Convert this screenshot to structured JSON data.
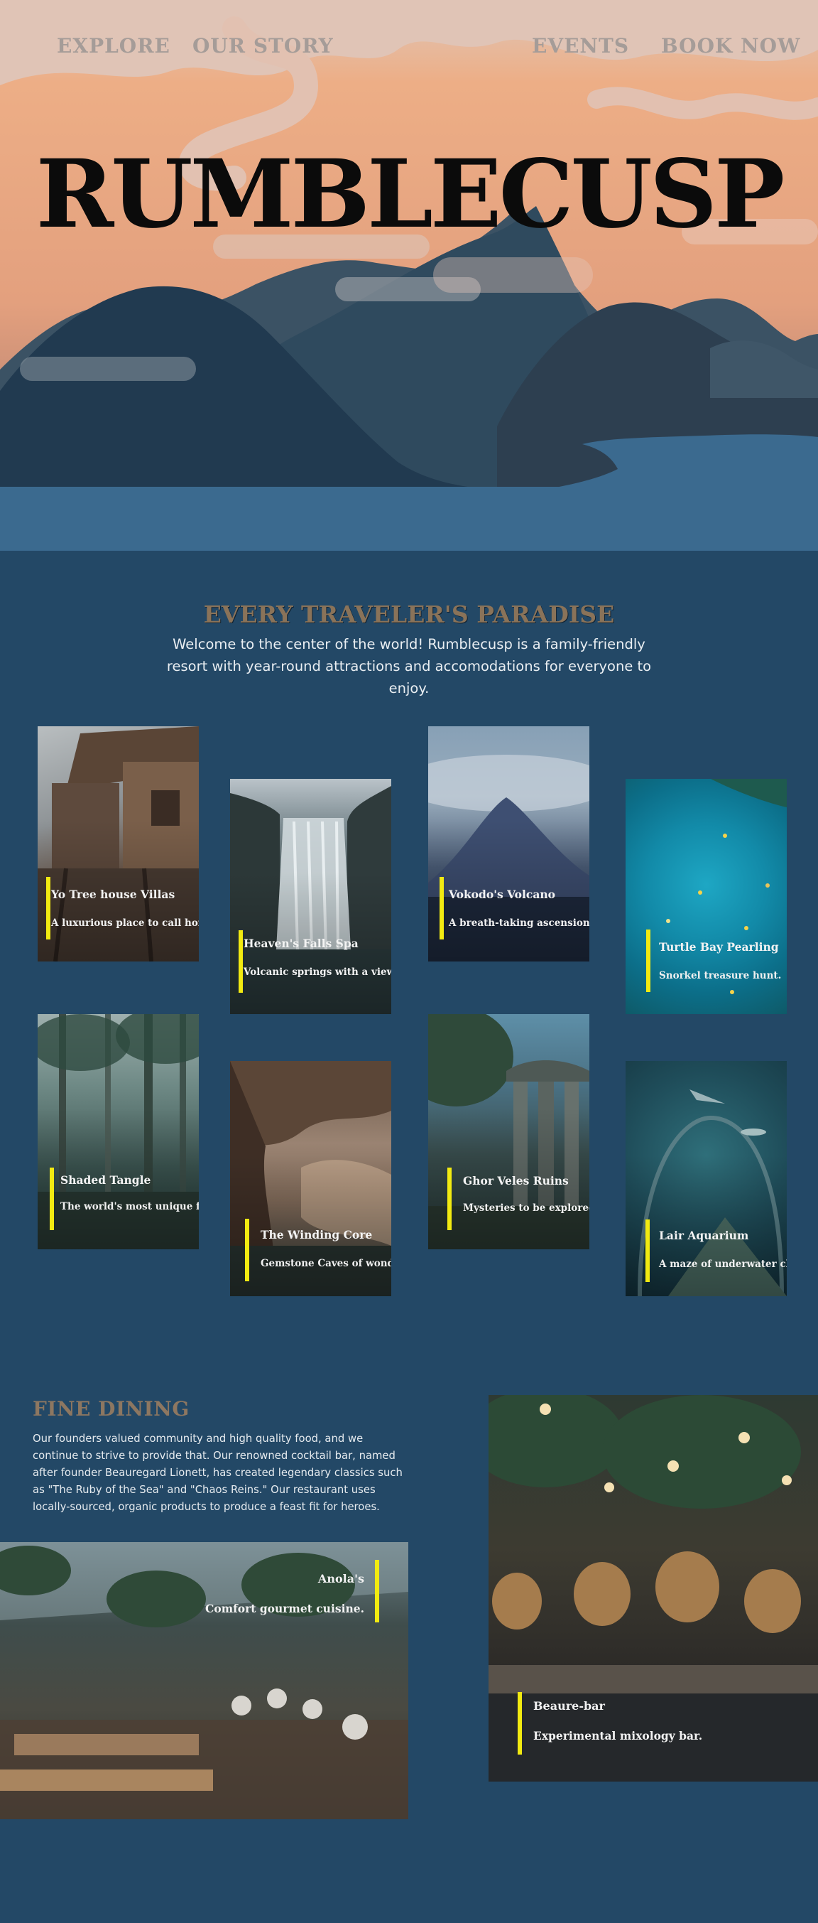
{
  "nav": {
    "explore": "EXPLORE",
    "our_story": "OUR STORY",
    "events": "EVENTS",
    "book_now": "BOOK NOW"
  },
  "hero": {
    "title": "RUMBLECUSP"
  },
  "attractions": {
    "heading": "EVERY TRAVELER'S PARADISE",
    "intro": "Welcome to the center of the world! Rumblecusp is a family-friendly resort with year-round attractions and accomodations for everyone to enjoy.",
    "cards": [
      {
        "title": "Yo Tree house Villas",
        "subtitle": "A luxurious place to call home."
      },
      {
        "title": "Heaven's Falls Spa",
        "subtitle": "Volcanic springs with a view."
      },
      {
        "title": "Vokodo's Volcano",
        "subtitle": "A breath-taking ascension."
      },
      {
        "title": "Turtle Bay Pearling",
        "subtitle": "Snorkel treasure hunt."
      },
      {
        "title": "Shaded Tangle",
        "subtitle": "The world's most unique forest."
      },
      {
        "title": "The Winding Core",
        "subtitle": "Gemstone Caves of wonder."
      },
      {
        "title": "Ghor Veles Ruins",
        "subtitle": "Mysteries to be explored."
      },
      {
        "title": "Lair Aquarium",
        "subtitle": "A maze of underwater chambers."
      }
    ]
  },
  "dining": {
    "title": "FINE DINING",
    "text": "Our founders valued community and high quality food, and we continue to strive to provide that. Our renowned cocktail bar, named after founder Beauregard Lionett, has created legendary classics such as \"The Ruby of the Sea\" and \"Chaos Reins.\" Our restaurant uses locally-sourced, organic products to produce a feast fit for heroes.",
    "restaurant": {
      "title": "Anola's",
      "subtitle": "Comfort gourmet cuisine."
    },
    "bar": {
      "title": "Beaure-bar",
      "subtitle": "Experimental mixology bar."
    }
  },
  "colors": {
    "background": "#234866",
    "accent_bar": "#f2ea11",
    "heading": "#8a7359",
    "hero_sky": "#e8a47c"
  }
}
